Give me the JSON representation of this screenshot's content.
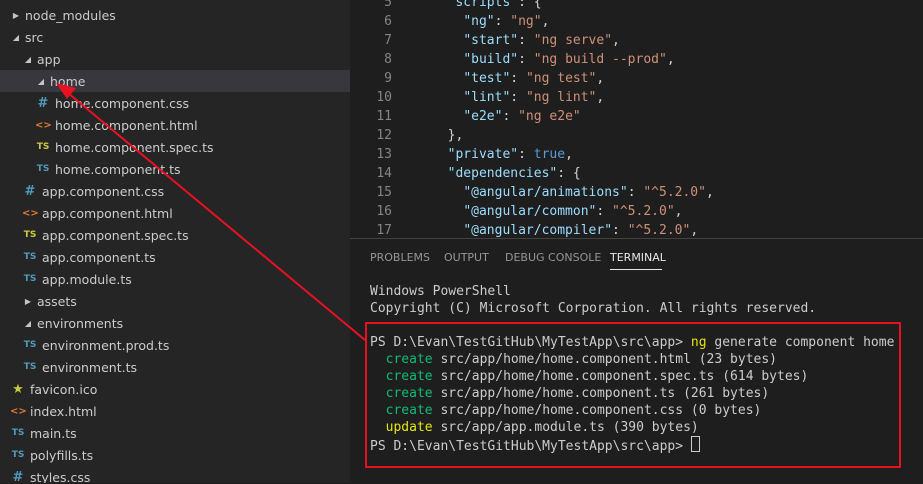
{
  "explorer": {
    "items": [
      {
        "label": "node_modules",
        "chevron": "▶",
        "icon": "",
        "icon_name": ""
      },
      {
        "label": "src",
        "chevron": "◢",
        "icon": "",
        "icon_name": ""
      },
      {
        "label": "app",
        "chevron": "◢",
        "icon": "",
        "icon_name": ""
      },
      {
        "label": "home",
        "chevron": "◢",
        "icon": "",
        "icon_name": ""
      },
      {
        "label": "home.component.css",
        "chevron": "",
        "icon": "#",
        "icon_name": "css-file-icon"
      },
      {
        "label": "home.component.html",
        "chevron": "",
        "icon": "<>",
        "icon_name": "html-file-icon"
      },
      {
        "label": "home.component.spec.ts",
        "chevron": "",
        "icon": "TS",
        "icon_name": "ts-spec-file-icon"
      },
      {
        "label": "home.component.ts",
        "chevron": "",
        "icon": "TS",
        "icon_name": "ts-file-icon"
      },
      {
        "label": "app.component.css",
        "chevron": "",
        "icon": "#",
        "icon_name": "css-file-icon"
      },
      {
        "label": "app.component.html",
        "chevron": "",
        "icon": "<>",
        "icon_name": "html-file-icon"
      },
      {
        "label": "app.component.spec.ts",
        "chevron": "",
        "icon": "TS",
        "icon_name": "ts-spec-file-icon"
      },
      {
        "label": "app.component.ts",
        "chevron": "",
        "icon": "TS",
        "icon_name": "ts-file-icon"
      },
      {
        "label": "app.module.ts",
        "chevron": "",
        "icon": "TS",
        "icon_name": "ts-file-icon"
      },
      {
        "label": "assets",
        "chevron": "▶",
        "icon": "",
        "icon_name": ""
      },
      {
        "label": "environments",
        "chevron": "◢",
        "icon": "",
        "icon_name": ""
      },
      {
        "label": "environment.prod.ts",
        "chevron": "",
        "icon": "TS",
        "icon_name": "ts-file-icon"
      },
      {
        "label": "environment.ts",
        "chevron": "",
        "icon": "TS",
        "icon_name": "ts-file-icon"
      },
      {
        "label": "favicon.ico",
        "chevron": "",
        "icon": "★",
        "icon_name": "star-file-icon"
      },
      {
        "label": "index.html",
        "chevron": "",
        "icon": "<>",
        "icon_name": "html-file-icon"
      },
      {
        "label": "main.ts",
        "chevron": "",
        "icon": "TS",
        "icon_name": "ts-file-icon"
      },
      {
        "label": "polyfills.ts",
        "chevron": "",
        "icon": "TS",
        "icon_name": "ts-file-icon"
      },
      {
        "label": "styles.css",
        "chevron": "",
        "icon": "#",
        "icon_name": "css-file-icon"
      }
    ],
    "selected": "home"
  },
  "editor": {
    "lines": [
      {
        "num": "5",
        "text": "  \"scripts\": {"
      },
      {
        "num": "6",
        "text": "    \"ng\": \"ng\","
      },
      {
        "num": "7",
        "text": "    \"start\": \"ng serve\","
      },
      {
        "num": "8",
        "text": "    \"build\": \"ng build --prod\","
      },
      {
        "num": "9",
        "text": "    \"test\": \"ng test\","
      },
      {
        "num": "10",
        "text": "    \"lint\": \"ng lint\","
      },
      {
        "num": "11",
        "text": "    \"e2e\": \"ng e2e\""
      },
      {
        "num": "12",
        "text": "  },"
      },
      {
        "num": "13",
        "text": "  \"private\": true,"
      },
      {
        "num": "14",
        "text": "  \"dependencies\": {"
      },
      {
        "num": "15",
        "text": "    \"@angular/animations\": \"^5.2.0\","
      },
      {
        "num": "16",
        "text": "    \"@angular/common\": \"^5.2.0\","
      },
      {
        "num": "17",
        "text": "    \"@angular/compiler\": \"^5.2.0\","
      }
    ]
  },
  "panel": {
    "tabs": [
      "PROBLEMS",
      "OUTPUT",
      "DEBUG CONSOLE",
      "TERMINAL"
    ],
    "active_tab": "TERMINAL"
  },
  "terminal": {
    "header1": "Windows PowerShell",
    "header2": "Copyright (C) Microsoft Corporation. All rights reserved.",
    "prompt": "PS D:\\Evan\\TestGitHub\\MyTestApp\\src\\app>",
    "command": "ng",
    "command_args": " generate component home",
    "output": [
      {
        "verb": "create",
        "text": " src/app/home/home.component.html (23 bytes)"
      },
      {
        "verb": "create",
        "text": " src/app/home/home.component.spec.ts (614 bytes)"
      },
      {
        "verb": "create",
        "text": " src/app/home/home.component.ts (261 bytes)"
      },
      {
        "verb": "create",
        "text": " src/app/home/home.component.css (0 bytes)"
      },
      {
        "verb": "update",
        "text": " src/app/app.module.ts (390 bytes)"
      }
    ]
  },
  "colors": {
    "annotation": "#e81123",
    "create": "#0dbc79",
    "update": "#e5e510"
  }
}
